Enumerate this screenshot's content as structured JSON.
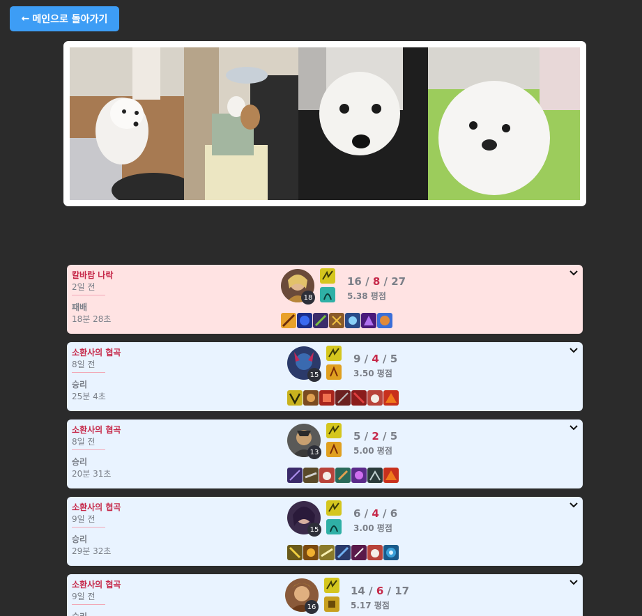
{
  "back_button": {
    "arrow": "←",
    "label": "메인으로 돌아가기"
  },
  "banner": {
    "photos": [
      "dog-photo-1",
      "dog-photo-2",
      "dog-photo-3",
      "dog-photo-4"
    ]
  },
  "matches": [
    {
      "result_class": "loss",
      "mode": "칼바람 나락",
      "when": "2일 전",
      "result": "패배",
      "duration": "18분 28초",
      "level": "18",
      "kills": "16",
      "deaths": "8",
      "assists": "27",
      "rating": "5.38 평점",
      "champion_color": "#6a4a3a",
      "spells": [
        "#d4c61e",
        "#2fb0a6"
      ],
      "items": [
        "#e9a12a",
        "#2244c8",
        "#3b2c6b",
        "#8a5a2a",
        "#4a88d8",
        "#6c2fb0",
        "#3b6fd8"
      ]
    },
    {
      "result_class": "win",
      "mode": "소환사의 협곡",
      "when": "8일 전",
      "result": "승리",
      "duration": "25분 4초",
      "level": "15",
      "kills": "9",
      "deaths": "4",
      "assists": "5",
      "rating": "3.50 평점",
      "champion_color": "#2b3a6a",
      "spells": [
        "#d4c61e",
        "#e0a020"
      ],
      "items": [
        "#c9b21e",
        "#7a4a20",
        "#a8241c",
        "#6b2020",
        "#8a1c1c",
        "#b8433a",
        "#c8301c"
      ]
    },
    {
      "result_class": "win",
      "mode": "소환사의 협곡",
      "when": "8일 전",
      "result": "승리",
      "duration": "20분 31초",
      "level": "13",
      "kills": "5",
      "deaths": "2",
      "assists": "5",
      "rating": "5.00 평점",
      "champion_color": "#5a5a58",
      "spells": [
        "#d4c61e",
        "#e0a020"
      ],
      "items": [
        "#3a2a6a",
        "#5a4a2a",
        "#b8433a",
        "#2a6a5a",
        "#5a2a8a",
        "#2a3a3a",
        "#c8301c"
      ]
    },
    {
      "result_class": "win",
      "mode": "소환사의 협곡",
      "when": "9일 전",
      "result": "승리",
      "duration": "29분 32초",
      "level": "15",
      "kills": "6",
      "deaths": "4",
      "assists": "6",
      "rating": "3.00 평점",
      "champion_color": "#3a2a4a",
      "spells": [
        "#d4c61e",
        "#2fb0a6"
      ],
      "items": [
        "#6a5a1a",
        "#7a4a10",
        "#8a7a2a",
        "#2a3a6a",
        "#5a1a4a",
        "#b8433a",
        "#3aa0d8"
      ]
    },
    {
      "result_class": "win",
      "mode": "소환사의 협곡",
      "when": "9일 전",
      "result": "승리",
      "duration": "",
      "level": "16",
      "kills": "14",
      "deaths": "6",
      "assists": "17",
      "rating": "5.17 평점",
      "champion_color": "#8a5a3a",
      "spells": [
        "#d4c61e",
        "#c8a01e"
      ],
      "items": []
    }
  ]
}
